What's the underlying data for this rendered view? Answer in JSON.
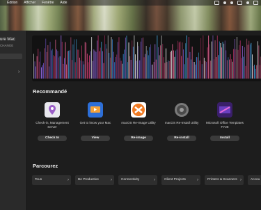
{
  "menubar": {
    "items": [
      "Édition",
      "Afficher",
      "Fenêtre",
      "Aide"
    ]
  },
  "sidebar": {
    "brand": "ure Mac",
    "sub": "CHANGE"
  },
  "recommended": {
    "title": "Recommandé",
    "apps": [
      {
        "name": "Check-in, Management Server",
        "button": "Check In",
        "icon": "location-pin-icon"
      },
      {
        "name": "Get to know your Mac",
        "button": "View",
        "icon": "keynote-icon"
      },
      {
        "name": "macOS Re-Image Utility",
        "button": "Re-image",
        "icon": "reimage-icon"
      },
      {
        "name": "macOS Re-Install Utility",
        "button": "Re-install",
        "icon": "gear-icon"
      },
      {
        "name": "Microsoft Office Templates FY28",
        "button": "Install",
        "icon": "office-templates-icon"
      }
    ]
  },
  "browse": {
    "title": "Parcourez",
    "categories": [
      "Tous",
      "Be Productive",
      "Connectivity",
      "Client Projects",
      "Printers & Scanners",
      "Accou"
    ]
  }
}
